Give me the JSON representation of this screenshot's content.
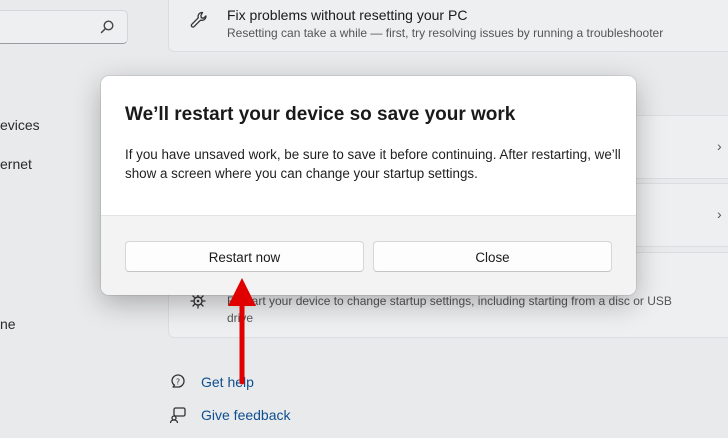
{
  "sidebar": {
    "items": [
      "evices",
      "ernet",
      "ne"
    ]
  },
  "cards": {
    "fix": {
      "title": "Fix problems without resetting your PC",
      "desc": "Resetting can take a while — first, try resolving issues by running a troubleshooter"
    },
    "startup": {
      "desc_line1": "Restart your device to change startup settings, including starting from a disc or USB",
      "desc_line2": "drive"
    }
  },
  "links": {
    "help": "Get help",
    "feedback": "Give feedback"
  },
  "dialog": {
    "title": "We’ll restart your device so save your work",
    "body": "If you have unsaved work, be sure to save it before continuing. After restarting, we’ll show a screen where you can change your startup settings.",
    "primary_button": "Restart now",
    "secondary_button": "Close"
  },
  "colors": {
    "arrow": "#e00000",
    "link": "#0e4f8f"
  }
}
